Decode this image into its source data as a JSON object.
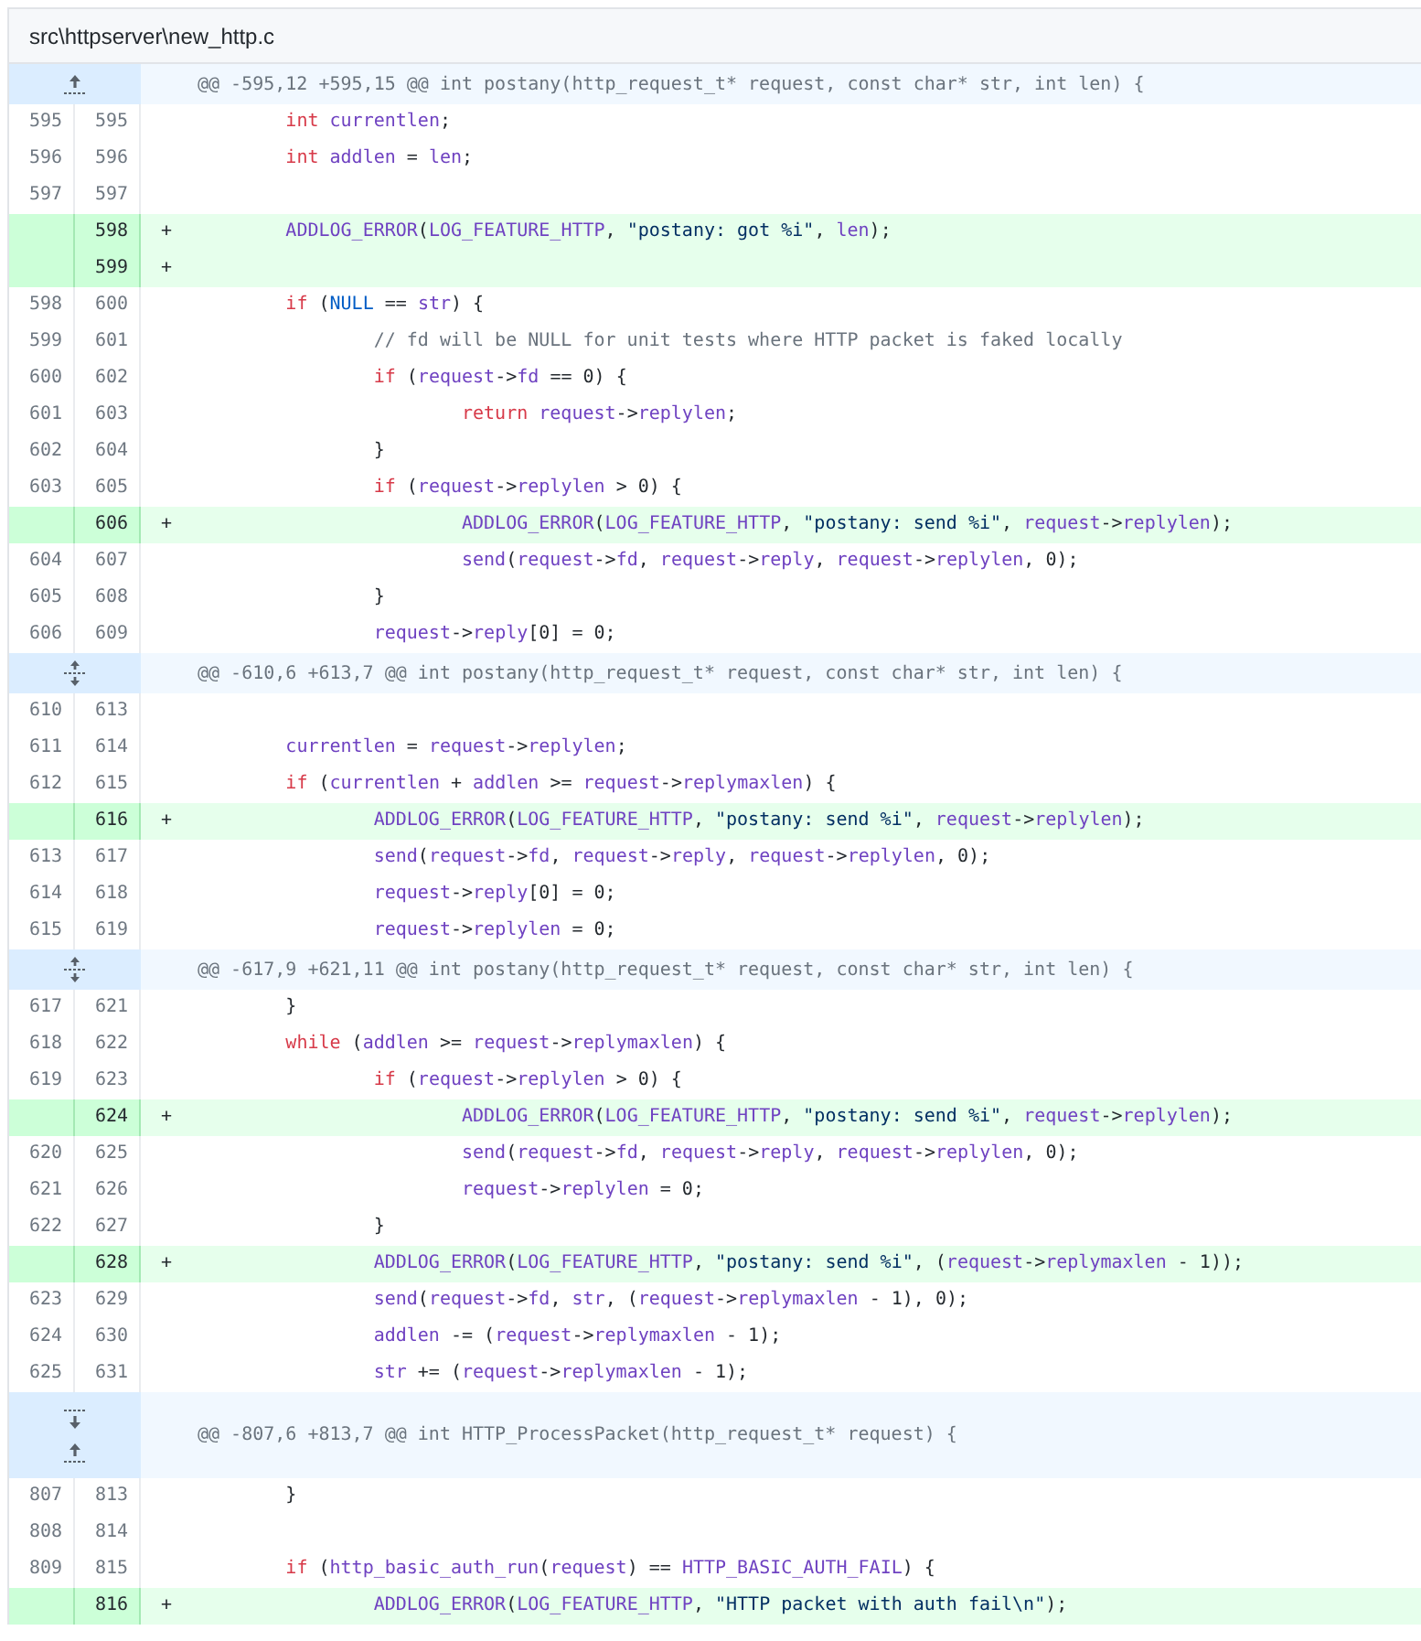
{
  "file": {
    "path": "src\\httpserver\\new_http.c"
  },
  "diff": [
    {
      "kind": "hunk",
      "expander": {
        "kind": "up"
      },
      "text": "@@ -595,12 +595,15 @@ int postany(http_request_t* request, const char* str, int len) {"
    },
    {
      "kind": "context",
      "old": "595",
      "new": "595",
      "code": [
        {
          "kind": "keyword",
          "text": "\tint"
        },
        {
          "kind": "name",
          "text": " currentlen"
        },
        {
          "kind": "plain",
          "text": ";"
        }
      ]
    },
    {
      "kind": "context",
      "old": "596",
      "new": "596",
      "code": [
        {
          "kind": "keyword",
          "text": "\tint"
        },
        {
          "kind": "name",
          "text": " addlen"
        },
        {
          "kind": "plain",
          "text": " = "
        },
        {
          "kind": "name",
          "text": "len"
        },
        {
          "kind": "plain",
          "text": ";"
        }
      ]
    },
    {
      "kind": "context",
      "old": "597",
      "new": "597"
    },
    {
      "kind": "added",
      "new": "598",
      "marker": "+",
      "code": [
        {
          "kind": "name",
          "text": "\tADDLOG_ERROR"
        },
        {
          "kind": "plain",
          "text": "("
        },
        {
          "kind": "name",
          "text": "LOG_FEATURE_HTTP"
        },
        {
          "kind": "plain",
          "text": ", "
        },
        {
          "kind": "string",
          "text": "\"postany: got %i\""
        },
        {
          "kind": "plain",
          "text": ", "
        },
        {
          "kind": "name",
          "text": "len"
        },
        {
          "kind": "plain",
          "text": ");"
        }
      ]
    },
    {
      "kind": "added",
      "new": "599",
      "marker": "+"
    },
    {
      "kind": "context",
      "old": "598",
      "new": "600",
      "code": [
        {
          "kind": "keyword",
          "text": "\tif"
        },
        {
          "kind": "plain",
          "text": " ("
        },
        {
          "kind": "constant",
          "text": "NULL"
        },
        {
          "kind": "plain",
          "text": " == "
        },
        {
          "kind": "name",
          "text": "str"
        },
        {
          "kind": "plain",
          "text": ") {"
        }
      ]
    },
    {
      "kind": "context",
      "old": "599",
      "new": "601",
      "code": [
        {
          "kind": "comment",
          "text": "\t\t// fd will be NULL for unit tests where HTTP packet is faked locally"
        }
      ]
    },
    {
      "kind": "context",
      "old": "600",
      "new": "602",
      "code": [
        {
          "kind": "keyword",
          "text": "\t\tif"
        },
        {
          "kind": "plain",
          "text": " ("
        },
        {
          "kind": "name",
          "text": "request"
        },
        {
          "kind": "plain",
          "text": "->"
        },
        {
          "kind": "name",
          "text": "fd"
        },
        {
          "kind": "plain",
          "text": " == 0) {"
        }
      ]
    },
    {
      "kind": "context",
      "old": "601",
      "new": "603",
      "code": [
        {
          "kind": "keyword",
          "text": "\t\t\treturn"
        },
        {
          "kind": "name",
          "text": " request"
        },
        {
          "kind": "plain",
          "text": "->"
        },
        {
          "kind": "name",
          "text": "replylen"
        },
        {
          "kind": "plain",
          "text": ";"
        }
      ]
    },
    {
      "kind": "context",
      "old": "602",
      "new": "604",
      "code": [
        {
          "kind": "plain",
          "text": "\t\t}"
        }
      ]
    },
    {
      "kind": "context",
      "old": "603",
      "new": "605",
      "code": [
        {
          "kind": "keyword",
          "text": "\t\tif"
        },
        {
          "kind": "plain",
          "text": " ("
        },
        {
          "kind": "name",
          "text": "request"
        },
        {
          "kind": "plain",
          "text": "->"
        },
        {
          "kind": "name",
          "text": "replylen"
        },
        {
          "kind": "plain",
          "text": " > 0) {"
        }
      ]
    },
    {
      "kind": "added",
      "new": "606",
      "marker": "+",
      "code": [
        {
          "kind": "name",
          "text": "\t\t\tADDLOG_ERROR"
        },
        {
          "kind": "plain",
          "text": "("
        },
        {
          "kind": "name",
          "text": "LOG_FEATURE_HTTP"
        },
        {
          "kind": "plain",
          "text": ", "
        },
        {
          "kind": "string",
          "text": "\"postany: send %i\""
        },
        {
          "kind": "plain",
          "text": ", "
        },
        {
          "kind": "name",
          "text": "request"
        },
        {
          "kind": "plain",
          "text": "->"
        },
        {
          "kind": "name",
          "text": "replylen"
        },
        {
          "kind": "plain",
          "text": ");"
        }
      ]
    },
    {
      "kind": "context",
      "old": "604",
      "new": "607",
      "code": [
        {
          "kind": "name",
          "text": "\t\t\tsend"
        },
        {
          "kind": "plain",
          "text": "("
        },
        {
          "kind": "name",
          "text": "request"
        },
        {
          "kind": "plain",
          "text": "->"
        },
        {
          "kind": "name",
          "text": "fd"
        },
        {
          "kind": "plain",
          "text": ", "
        },
        {
          "kind": "name",
          "text": "request"
        },
        {
          "kind": "plain",
          "text": "->"
        },
        {
          "kind": "name",
          "text": "reply"
        },
        {
          "kind": "plain",
          "text": ", "
        },
        {
          "kind": "name",
          "text": "request"
        },
        {
          "kind": "plain",
          "text": "->"
        },
        {
          "kind": "name",
          "text": "replylen"
        },
        {
          "kind": "plain",
          "text": ", 0);"
        }
      ]
    },
    {
      "kind": "context",
      "old": "605",
      "new": "608",
      "code": [
        {
          "kind": "plain",
          "text": "\t\t}"
        }
      ]
    },
    {
      "kind": "context",
      "old": "606",
      "new": "609",
      "code": [
        {
          "kind": "name",
          "text": "\t\trequest"
        },
        {
          "kind": "plain",
          "text": "->"
        },
        {
          "kind": "name",
          "text": "reply"
        },
        {
          "kind": "plain",
          "text": "[0] = 0;"
        }
      ]
    },
    {
      "kind": "hunk",
      "expander": {
        "kind": "both"
      },
      "text": "@@ -610,6 +613,7 @@ int postany(http_request_t* request, const char* str, int len) {"
    },
    {
      "kind": "context",
      "old": "610",
      "new": "613"
    },
    {
      "kind": "context",
      "old": "611",
      "new": "614",
      "code": [
        {
          "kind": "name",
          "text": "\tcurrentlen"
        },
        {
          "kind": "plain",
          "text": " = "
        },
        {
          "kind": "name",
          "text": "request"
        },
        {
          "kind": "plain",
          "text": "->"
        },
        {
          "kind": "name",
          "text": "replylen"
        },
        {
          "kind": "plain",
          "text": ";"
        }
      ]
    },
    {
      "kind": "context",
      "old": "612",
      "new": "615",
      "code": [
        {
          "kind": "keyword",
          "text": "\tif"
        },
        {
          "kind": "plain",
          "text": " ("
        },
        {
          "kind": "name",
          "text": "currentlen"
        },
        {
          "kind": "plain",
          "text": " + "
        },
        {
          "kind": "name",
          "text": "addlen"
        },
        {
          "kind": "plain",
          "text": " >= "
        },
        {
          "kind": "name",
          "text": "request"
        },
        {
          "kind": "plain",
          "text": "->"
        },
        {
          "kind": "name",
          "text": "replymaxlen"
        },
        {
          "kind": "plain",
          "text": ") {"
        }
      ]
    },
    {
      "kind": "added",
      "new": "616",
      "marker": "+",
      "code": [
        {
          "kind": "name",
          "text": "\t\tADDLOG_ERROR"
        },
        {
          "kind": "plain",
          "text": "("
        },
        {
          "kind": "name",
          "text": "LOG_FEATURE_HTTP"
        },
        {
          "kind": "plain",
          "text": ", "
        },
        {
          "kind": "string",
          "text": "\"postany: send %i\""
        },
        {
          "kind": "plain",
          "text": ", "
        },
        {
          "kind": "name",
          "text": "request"
        },
        {
          "kind": "plain",
          "text": "->"
        },
        {
          "kind": "name",
          "text": "replylen"
        },
        {
          "kind": "plain",
          "text": ");"
        }
      ]
    },
    {
      "kind": "context",
      "old": "613",
      "new": "617",
      "code": [
        {
          "kind": "name",
          "text": "\t\tsend"
        },
        {
          "kind": "plain",
          "text": "("
        },
        {
          "kind": "name",
          "text": "request"
        },
        {
          "kind": "plain",
          "text": "->"
        },
        {
          "kind": "name",
          "text": "fd"
        },
        {
          "kind": "plain",
          "text": ", "
        },
        {
          "kind": "name",
          "text": "request"
        },
        {
          "kind": "plain",
          "text": "->"
        },
        {
          "kind": "name",
          "text": "reply"
        },
        {
          "kind": "plain",
          "text": ", "
        },
        {
          "kind": "name",
          "text": "request"
        },
        {
          "kind": "plain",
          "text": "->"
        },
        {
          "kind": "name",
          "text": "replylen"
        },
        {
          "kind": "plain",
          "text": ", 0);"
        }
      ]
    },
    {
      "kind": "context",
      "old": "614",
      "new": "618",
      "code": [
        {
          "kind": "name",
          "text": "\t\trequest"
        },
        {
          "kind": "plain",
          "text": "->"
        },
        {
          "kind": "name",
          "text": "reply"
        },
        {
          "kind": "plain",
          "text": "[0] = 0;"
        }
      ]
    },
    {
      "kind": "context",
      "old": "615",
      "new": "619",
      "code": [
        {
          "kind": "name",
          "text": "\t\trequest"
        },
        {
          "kind": "plain",
          "text": "->"
        },
        {
          "kind": "name",
          "text": "replylen"
        },
        {
          "kind": "plain",
          "text": " = 0;"
        }
      ]
    },
    {
      "kind": "hunk",
      "expander": {
        "kind": "both"
      },
      "text": "@@ -617,9 +621,11 @@ int postany(http_request_t* request, const char* str, int len) {"
    },
    {
      "kind": "context",
      "old": "617",
      "new": "621",
      "code": [
        {
          "kind": "plain",
          "text": "\t}"
        }
      ]
    },
    {
      "kind": "context",
      "old": "618",
      "new": "622",
      "code": [
        {
          "kind": "keyword",
          "text": "\twhile"
        },
        {
          "kind": "plain",
          "text": " ("
        },
        {
          "kind": "name",
          "text": "addlen"
        },
        {
          "kind": "plain",
          "text": " >= "
        },
        {
          "kind": "name",
          "text": "request"
        },
        {
          "kind": "plain",
          "text": "->"
        },
        {
          "kind": "name",
          "text": "replymaxlen"
        },
        {
          "kind": "plain",
          "text": ") {"
        }
      ]
    },
    {
      "kind": "context",
      "old": "619",
      "new": "623",
      "code": [
        {
          "kind": "keyword",
          "text": "\t\tif"
        },
        {
          "kind": "plain",
          "text": " ("
        },
        {
          "kind": "name",
          "text": "request"
        },
        {
          "kind": "plain",
          "text": "->"
        },
        {
          "kind": "name",
          "text": "replylen"
        },
        {
          "kind": "plain",
          "text": " > 0) {"
        }
      ]
    },
    {
      "kind": "added",
      "new": "624",
      "marker": "+",
      "code": [
        {
          "kind": "name",
          "text": "\t\t\tADDLOG_ERROR"
        },
        {
          "kind": "plain",
          "text": "("
        },
        {
          "kind": "name",
          "text": "LOG_FEATURE_HTTP"
        },
        {
          "kind": "plain",
          "text": ", "
        },
        {
          "kind": "string",
          "text": "\"postany: send %i\""
        },
        {
          "kind": "plain",
          "text": ", "
        },
        {
          "kind": "name",
          "text": "request"
        },
        {
          "kind": "plain",
          "text": "->"
        },
        {
          "kind": "name",
          "text": "replylen"
        },
        {
          "kind": "plain",
          "text": ");"
        }
      ]
    },
    {
      "kind": "context",
      "old": "620",
      "new": "625",
      "code": [
        {
          "kind": "name",
          "text": "\t\t\tsend"
        },
        {
          "kind": "plain",
          "text": "("
        },
        {
          "kind": "name",
          "text": "request"
        },
        {
          "kind": "plain",
          "text": "->"
        },
        {
          "kind": "name",
          "text": "fd"
        },
        {
          "kind": "plain",
          "text": ", "
        },
        {
          "kind": "name",
          "text": "request"
        },
        {
          "kind": "plain",
          "text": "->"
        },
        {
          "kind": "name",
          "text": "reply"
        },
        {
          "kind": "plain",
          "text": ", "
        },
        {
          "kind": "name",
          "text": "request"
        },
        {
          "kind": "plain",
          "text": "->"
        },
        {
          "kind": "name",
          "text": "replylen"
        },
        {
          "kind": "plain",
          "text": ", 0);"
        }
      ]
    },
    {
      "kind": "context",
      "old": "621",
      "new": "626",
      "code": [
        {
          "kind": "name",
          "text": "\t\t\trequest"
        },
        {
          "kind": "plain",
          "text": "->"
        },
        {
          "kind": "name",
          "text": "replylen"
        },
        {
          "kind": "plain",
          "text": " = 0;"
        }
      ]
    },
    {
      "kind": "context",
      "old": "622",
      "new": "627",
      "code": [
        {
          "kind": "plain",
          "text": "\t\t}"
        }
      ]
    },
    {
      "kind": "added",
      "new": "628",
      "marker": "+",
      "code": [
        {
          "kind": "name",
          "text": "\t\tADDLOG_ERROR"
        },
        {
          "kind": "plain",
          "text": "("
        },
        {
          "kind": "name",
          "text": "LOG_FEATURE_HTTP"
        },
        {
          "kind": "plain",
          "text": ", "
        },
        {
          "kind": "string",
          "text": "\"postany: send %i\""
        },
        {
          "kind": "plain",
          "text": ", ("
        },
        {
          "kind": "name",
          "text": "request"
        },
        {
          "kind": "plain",
          "text": "->"
        },
        {
          "kind": "name",
          "text": "replymaxlen"
        },
        {
          "kind": "plain",
          "text": " - 1));"
        }
      ]
    },
    {
      "kind": "context",
      "old": "623",
      "new": "629",
      "code": [
        {
          "kind": "name",
          "text": "\t\tsend"
        },
        {
          "kind": "plain",
          "text": "("
        },
        {
          "kind": "name",
          "text": "request"
        },
        {
          "kind": "plain",
          "text": "->"
        },
        {
          "kind": "name",
          "text": "fd"
        },
        {
          "kind": "plain",
          "text": ", "
        },
        {
          "kind": "name",
          "text": "str"
        },
        {
          "kind": "plain",
          "text": ", ("
        },
        {
          "kind": "name",
          "text": "request"
        },
        {
          "kind": "plain",
          "text": "->"
        },
        {
          "kind": "name",
          "text": "replymaxlen"
        },
        {
          "kind": "plain",
          "text": " - 1), 0);"
        }
      ]
    },
    {
      "kind": "context",
      "old": "624",
      "new": "630",
      "code": [
        {
          "kind": "name",
          "text": "\t\taddlen"
        },
        {
          "kind": "plain",
          "text": " -= ("
        },
        {
          "kind": "name",
          "text": "request"
        },
        {
          "kind": "plain",
          "text": "->"
        },
        {
          "kind": "name",
          "text": "replymaxlen"
        },
        {
          "kind": "plain",
          "text": " - 1);"
        }
      ]
    },
    {
      "kind": "context",
      "old": "625",
      "new": "631",
      "code": [
        {
          "kind": "name",
          "text": "\t\tstr"
        },
        {
          "kind": "plain",
          "text": " += ("
        },
        {
          "kind": "name",
          "text": "request"
        },
        {
          "kind": "plain",
          "text": "->"
        },
        {
          "kind": "name",
          "text": "replymaxlen"
        },
        {
          "kind": "plain",
          "text": " - 1);"
        }
      ]
    },
    {
      "kind": "hunk",
      "expander": {
        "kind": "down_up"
      },
      "text": "@@ -807,6 +813,7 @@ int HTTP_ProcessPacket(http_request_t* request) {"
    },
    {
      "kind": "context",
      "old": "807",
      "new": "813",
      "code": [
        {
          "kind": "plain",
          "text": "\t}"
        }
      ]
    },
    {
      "kind": "context",
      "old": "808",
      "new": "814"
    },
    {
      "kind": "context",
      "old": "809",
      "new": "815",
      "code": [
        {
          "kind": "keyword",
          "text": "\tif"
        },
        {
          "kind": "plain",
          "text": " ("
        },
        {
          "kind": "name",
          "text": "http_basic_auth_run"
        },
        {
          "kind": "plain",
          "text": "("
        },
        {
          "kind": "name",
          "text": "request"
        },
        {
          "kind": "plain",
          "text": ") == "
        },
        {
          "kind": "name",
          "text": "HTTP_BASIC_AUTH_FAIL"
        },
        {
          "kind": "plain",
          "text": ") {"
        }
      ]
    },
    {
      "kind": "added",
      "new": "816",
      "marker": "+",
      "code": [
        {
          "kind": "name",
          "text": "\t\tADDLOG_ERROR"
        },
        {
          "kind": "plain",
          "text": "("
        },
        {
          "kind": "name",
          "text": "LOG_FEATURE_HTTP"
        },
        {
          "kind": "plain",
          "text": ", "
        },
        {
          "kind": "string",
          "text": "\"HTTP packet with auth fail\\n\""
        },
        {
          "kind": "plain",
          "text": ");"
        }
      ]
    }
  ]
}
